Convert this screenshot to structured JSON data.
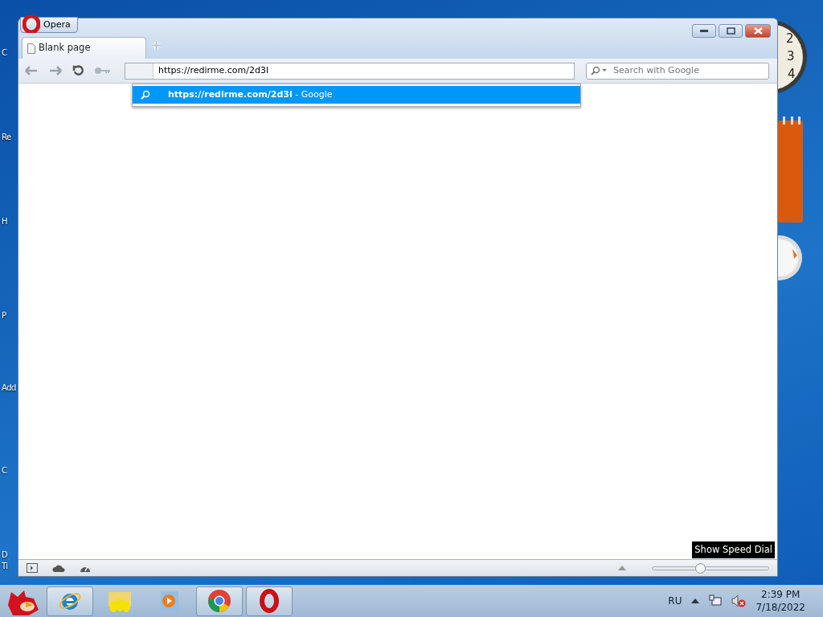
{
  "desktop_icons": [
    {
      "label": "C"
    },
    {
      "label": "Re"
    },
    {
      "label": "H"
    },
    {
      "label": "P"
    },
    {
      "label": "Add"
    },
    {
      "label": "C"
    },
    {
      "label": "D"
    },
    {
      "label": "Ti"
    }
  ],
  "clock_numbers": [
    "2",
    "3",
    "4"
  ],
  "window": {
    "menu_button": "Opera",
    "tabs": [
      {
        "label": "Blank page",
        "selected": true
      }
    ],
    "address": {
      "value": "https://redirme.com/2d3l"
    },
    "suggestions": [
      {
        "url": "https://redirme.com/2d3l",
        "suffix": " - Google",
        "selected": true
      }
    ],
    "search": {
      "placeholder": "Search with Google"
    },
    "tooltip": "Show Speed Dial",
    "zoom": {
      "level": 0.41
    }
  },
  "taskbar": {
    "apps": [
      {
        "kind": "ie",
        "running": true
      },
      {
        "kind": "folder",
        "running": false
      },
      {
        "kind": "media",
        "running": false
      },
      {
        "kind": "chrome",
        "running": true
      },
      {
        "kind": "opera",
        "running": true
      }
    ],
    "language": "RU",
    "time": "2:39 PM",
    "date": "7/18/2022"
  }
}
